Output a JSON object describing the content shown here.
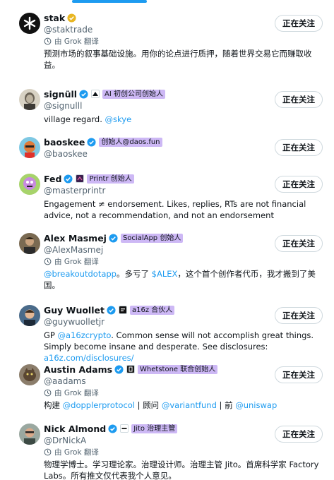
{
  "colors": {
    "accent": "#1d9bf0",
    "secondary_text": "#536471",
    "affiliate_bg": "#cdb8f5",
    "verified_gold": "#e8b622"
  },
  "follow_label": "正在关注",
  "translate_label": "由 Grok 翻译",
  "users": [
    {
      "name": "stak",
      "badge": "gold-verified-icon",
      "handle": "@staktrade",
      "translated": true,
      "bio": [
        {
          "t": "预测市场的叙事基础设施。用你的论点进行质押，随着世界交易它而赚取收益。"
        }
      ],
      "affiliate": ""
    },
    {
      "name": "signüll",
      "badge": "blue-verified-icon",
      "handle": "@signulll",
      "translated": false,
      "bio": [
        {
          "t": "village regard. "
        },
        {
          "t": "@skye",
          "link": true
        }
      ],
      "affiliate": "AI 初创公司创始人"
    },
    {
      "name": "baoskee",
      "badge": "blue-verified-icon",
      "handle": "@baoskee",
      "translated": false,
      "bio": [],
      "affiliate": "创始人@daos.fun"
    },
    {
      "name": "Fed",
      "badge": "blue-verified-icon",
      "handle": "@masterprintr",
      "translated": false,
      "bio": [
        {
          "t": "Engagement ≠ endorsement. Likes, replies, RTs are not financial advice, not a recommendation, and not an endorsement"
        }
      ],
      "affiliate": "Printr 创始人"
    },
    {
      "name": "Alex Masmej",
      "badge": "blue-verified-icon",
      "handle": "@AlexMasmej",
      "translated": true,
      "bio": [
        {
          "t": "@breakoutdotapp",
          "link": true
        },
        {
          "t": "。多亏了 "
        },
        {
          "t": "$ALEX",
          "link": true
        },
        {
          "t": "，这个首个创作者代币，我才搬到了美国。"
        }
      ],
      "affiliate": "SocialApp 创始人"
    },
    {
      "name": "Guy Wuollet",
      "badge": "blue-verified-icon",
      "handle": "@guywuolletjr",
      "translated": false,
      "bio": [
        {
          "t": "GP "
        },
        {
          "t": "@a16zcrypto",
          "link": true
        },
        {
          "t": ". Common sense will not accomplish great things. Simply become insane and desperate. See disclosures: "
        },
        {
          "t": "a16z.com/disclosures/",
          "link": true
        }
      ],
      "affiliate": "a16z 合伙人"
    },
    {
      "name": "Austin Adams",
      "badge": "blue-verified-icon",
      "handle": "@aadams",
      "translated": true,
      "bio": [
        {
          "t": "构建 "
        },
        {
          "t": "@dopplerprotocol",
          "link": true
        },
        {
          "t": " | 顾问 "
        },
        {
          "t": "@variantfund",
          "link": true
        },
        {
          "t": " | 前 "
        },
        {
          "t": "@uniswap",
          "link": true
        }
      ],
      "affiliate": "Whetstone 联合创始人"
    },
    {
      "name": "Nick Almond",
      "badge": "blue-verified-icon",
      "handle": "@DrNickA",
      "translated": true,
      "bio": [
        {
          "t": "物理学博士。学习理论家。治理设计师。治理主管 Jito。首席科学家 Factory Labs。所有推文仅代表我个人意见。"
        }
      ],
      "affiliate": "Jito 治理主管"
    }
  ]
}
